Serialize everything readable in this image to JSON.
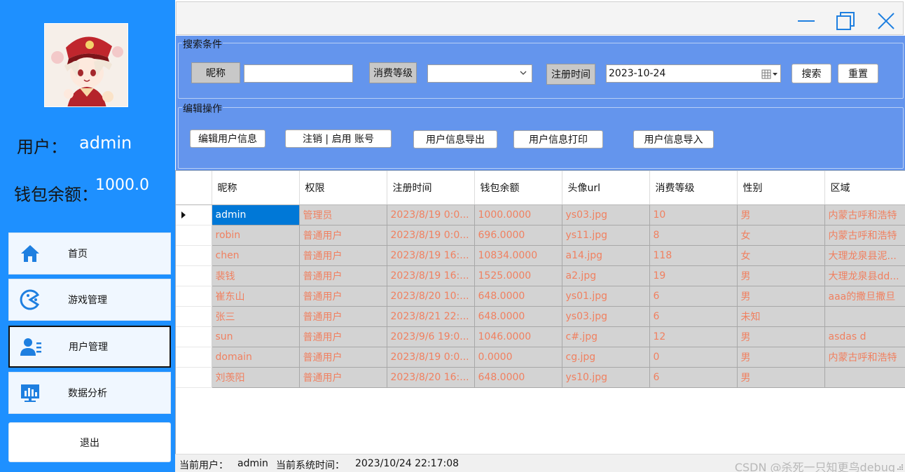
{
  "sidebar": {
    "user_label": "用户：",
    "username": "admin",
    "wallet_label": "钱包余额：",
    "wallet_value": "1000.0",
    "nav": {
      "home": "首页",
      "games": "游戏管理",
      "users": "用户管理",
      "analytics": "数据分析",
      "exit": "退出"
    }
  },
  "search": {
    "group_title": "搜索条件",
    "nickname_label": "昵称",
    "nickname_value": "",
    "level_label": "消费等级",
    "level_value": "",
    "regtime_label": "注册时间",
    "regtime_value": "2023-10-24",
    "search_button": "搜索",
    "reset_button": "重置"
  },
  "edit": {
    "group_title": "编辑操作",
    "edit_button": "编辑用户信息",
    "toggle_button": "注销 | 启用 账号",
    "export_button": "用户信息导出",
    "print_button": "用户信息打印",
    "import_button": "用户信息导入"
  },
  "grid": {
    "columns": [
      "昵称",
      "权限",
      "注册时间",
      "钱包余额",
      "头像url",
      "消费等级",
      "性别",
      "区域"
    ],
    "rows": [
      [
        "admin",
        "管理员",
        "2023/8/19 0:0...",
        "1000.0000",
        "ys03.jpg",
        "10",
        "男",
        "内蒙古呼和浩特"
      ],
      [
        "robin",
        "普通用户",
        "2023/8/19 0:0...",
        "696.0000",
        "ys11.jpg",
        "8",
        "女",
        "内蒙古呼和浩特"
      ],
      [
        "chen",
        "普通用户",
        "2023/8/19 16:...",
        "10834.0000",
        "a14.jpg",
        "118",
        "女",
        "大理龙泉县泥..."
      ],
      [
        "裴钱",
        "普通用户",
        "2023/8/19 16:...",
        "1525.0000",
        "a2.jpg",
        "19",
        "男",
        "大理龙泉县dd..."
      ],
      [
        "崔东山",
        "普通用户",
        "2023/8/20 10:...",
        "648.0000",
        "ys01.jpg",
        "6",
        "男",
        "aaa的撒旦撒旦"
      ],
      [
        "张三",
        "普通用户",
        "2023/8/21 22:...",
        "648.0000",
        "ys03.jpg",
        "6",
        "未知",
        ""
      ],
      [
        "sun",
        "普通用户",
        "2023/9/6 19:0...",
        "1046.0000",
        "c#.jpg",
        "12",
        "男",
        "asdas d"
      ],
      [
        "domain",
        "普通用户",
        "2023/8/19 0:0...",
        "0.0000",
        "cg.jpg",
        "0",
        "男",
        "内蒙古呼和浩特"
      ],
      [
        "刘羡阳",
        "普通用户",
        "2023/8/20 16:...",
        "648.0000",
        "ys10.jpg",
        "6",
        "男",
        ""
      ]
    ]
  },
  "status": {
    "current_user_label": "当前用户：",
    "current_user": "admin",
    "time_label": "当前系统时间：",
    "time_value": "2023/10/24 22:17:08"
  },
  "watermark": "CSDN @杀死一只知更鸟debug",
  "colors": {
    "sidebar_bg": "#1e90ff",
    "group_bg": "#6495ed",
    "cell_bg": "#d3d3d3",
    "cell_text": "#f08060",
    "selected_cell": "#0078d7",
    "icon_blue": "#1e7fe0"
  }
}
